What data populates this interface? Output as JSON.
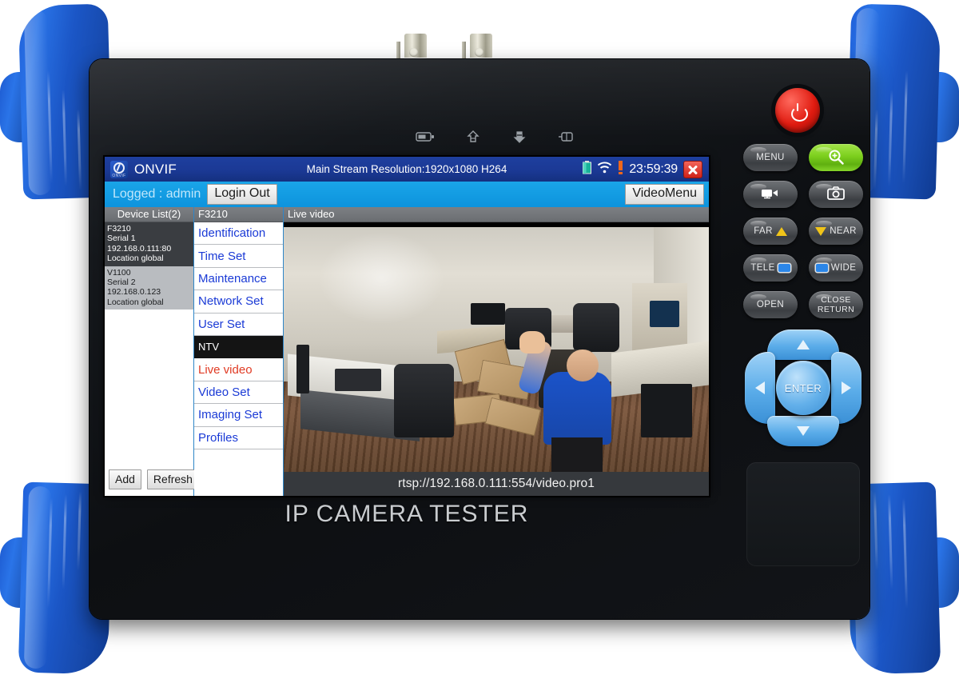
{
  "device": {
    "brand": "IP CAMERA TESTER",
    "top_leds": [
      "battery-led",
      "upload-led",
      "download-led",
      "dc-power-led"
    ],
    "connectors": [
      "bnc-connector-1",
      "bnc-connector-2"
    ]
  },
  "app": {
    "logo_label": "ONVIF",
    "title": "ONVIF",
    "stream_info": "Main Stream Resolution:1920x1080 H264",
    "clock": "23:59:39",
    "close_label": "close",
    "status_icons": [
      "battery-icon",
      "wifi-icon",
      "signal-icon"
    ]
  },
  "loginbar": {
    "logged_text": "Logged : admin",
    "login_out_label": "Login Out",
    "video_menu_label": "VideoMenu"
  },
  "devices": {
    "header": "Device List(2)",
    "items": [
      {
        "name": "F3210",
        "serial": "Serial 1",
        "address": "192.168.0.111:80",
        "location": "Location global",
        "selected": true
      },
      {
        "name": "V1100",
        "serial": "Serial 2",
        "address": "192.168.0.123",
        "location": "Location global",
        "selected": false
      }
    ],
    "add_label": "Add",
    "refresh_label": "Refresh"
  },
  "menu": {
    "header": "F3210",
    "items": [
      {
        "label": "Identification",
        "type": "link"
      },
      {
        "label": "Time Set",
        "type": "link"
      },
      {
        "label": "Maintenance",
        "type": "link"
      },
      {
        "label": "Network Set",
        "type": "link"
      },
      {
        "label": "User Set",
        "type": "link"
      },
      {
        "label": "NTV",
        "type": "section"
      },
      {
        "label": "Live video",
        "type": "active"
      },
      {
        "label": "Video Set",
        "type": "link"
      },
      {
        "label": "Imaging Set",
        "type": "link"
      },
      {
        "label": "Profiles",
        "type": "link"
      }
    ]
  },
  "video": {
    "header": "Live video",
    "rtsp_url": "rtsp://192.168.0.111:554/video.pro1"
  },
  "keypad": {
    "power_label": "power",
    "buttons": [
      {
        "label": "MENU",
        "name": "menu-button",
        "style": "gray"
      },
      {
        "label": "",
        "name": "zoom-in-button",
        "style": "green",
        "icon": "magnifier-plus-icon"
      },
      {
        "label": "",
        "name": "video-record-button",
        "style": "gray",
        "icon": "video-camera-icon"
      },
      {
        "label": "",
        "name": "snapshot-button",
        "style": "gray",
        "icon": "camera-icon"
      },
      {
        "label": "FAR",
        "name": "focus-far-button",
        "style": "gray",
        "icon": "triangle-up-icon"
      },
      {
        "label": "NEAR",
        "name": "focus-near-button",
        "style": "gray",
        "icon": "triangle-down-icon"
      },
      {
        "label": "TELE",
        "name": "zoom-tele-button",
        "style": "gray",
        "icon": "screen-icon"
      },
      {
        "label": "WIDE",
        "name": "zoom-wide-button",
        "style": "gray",
        "icon": "screen-icon"
      },
      {
        "label": "OPEN",
        "name": "iris-open-button",
        "style": "gray"
      },
      {
        "label": "CLOSE",
        "label2": "RETURN",
        "name": "iris-close-return-button",
        "style": "gray"
      }
    ],
    "dpad": {
      "up": "up",
      "down": "down",
      "left": "left",
      "right": "right",
      "enter_label": "ENTER"
    }
  },
  "colors": {
    "case_blue": "#1b56c6",
    "titlebar_blue": "#1b3995",
    "loginbar_blue": "#0d93dd",
    "menu_link": "#1a3ad6",
    "menu_active": "#e03a23",
    "power_red": "#e01b10",
    "key_green": "#7ccf1d",
    "dpad_blue": "#5aace9"
  }
}
